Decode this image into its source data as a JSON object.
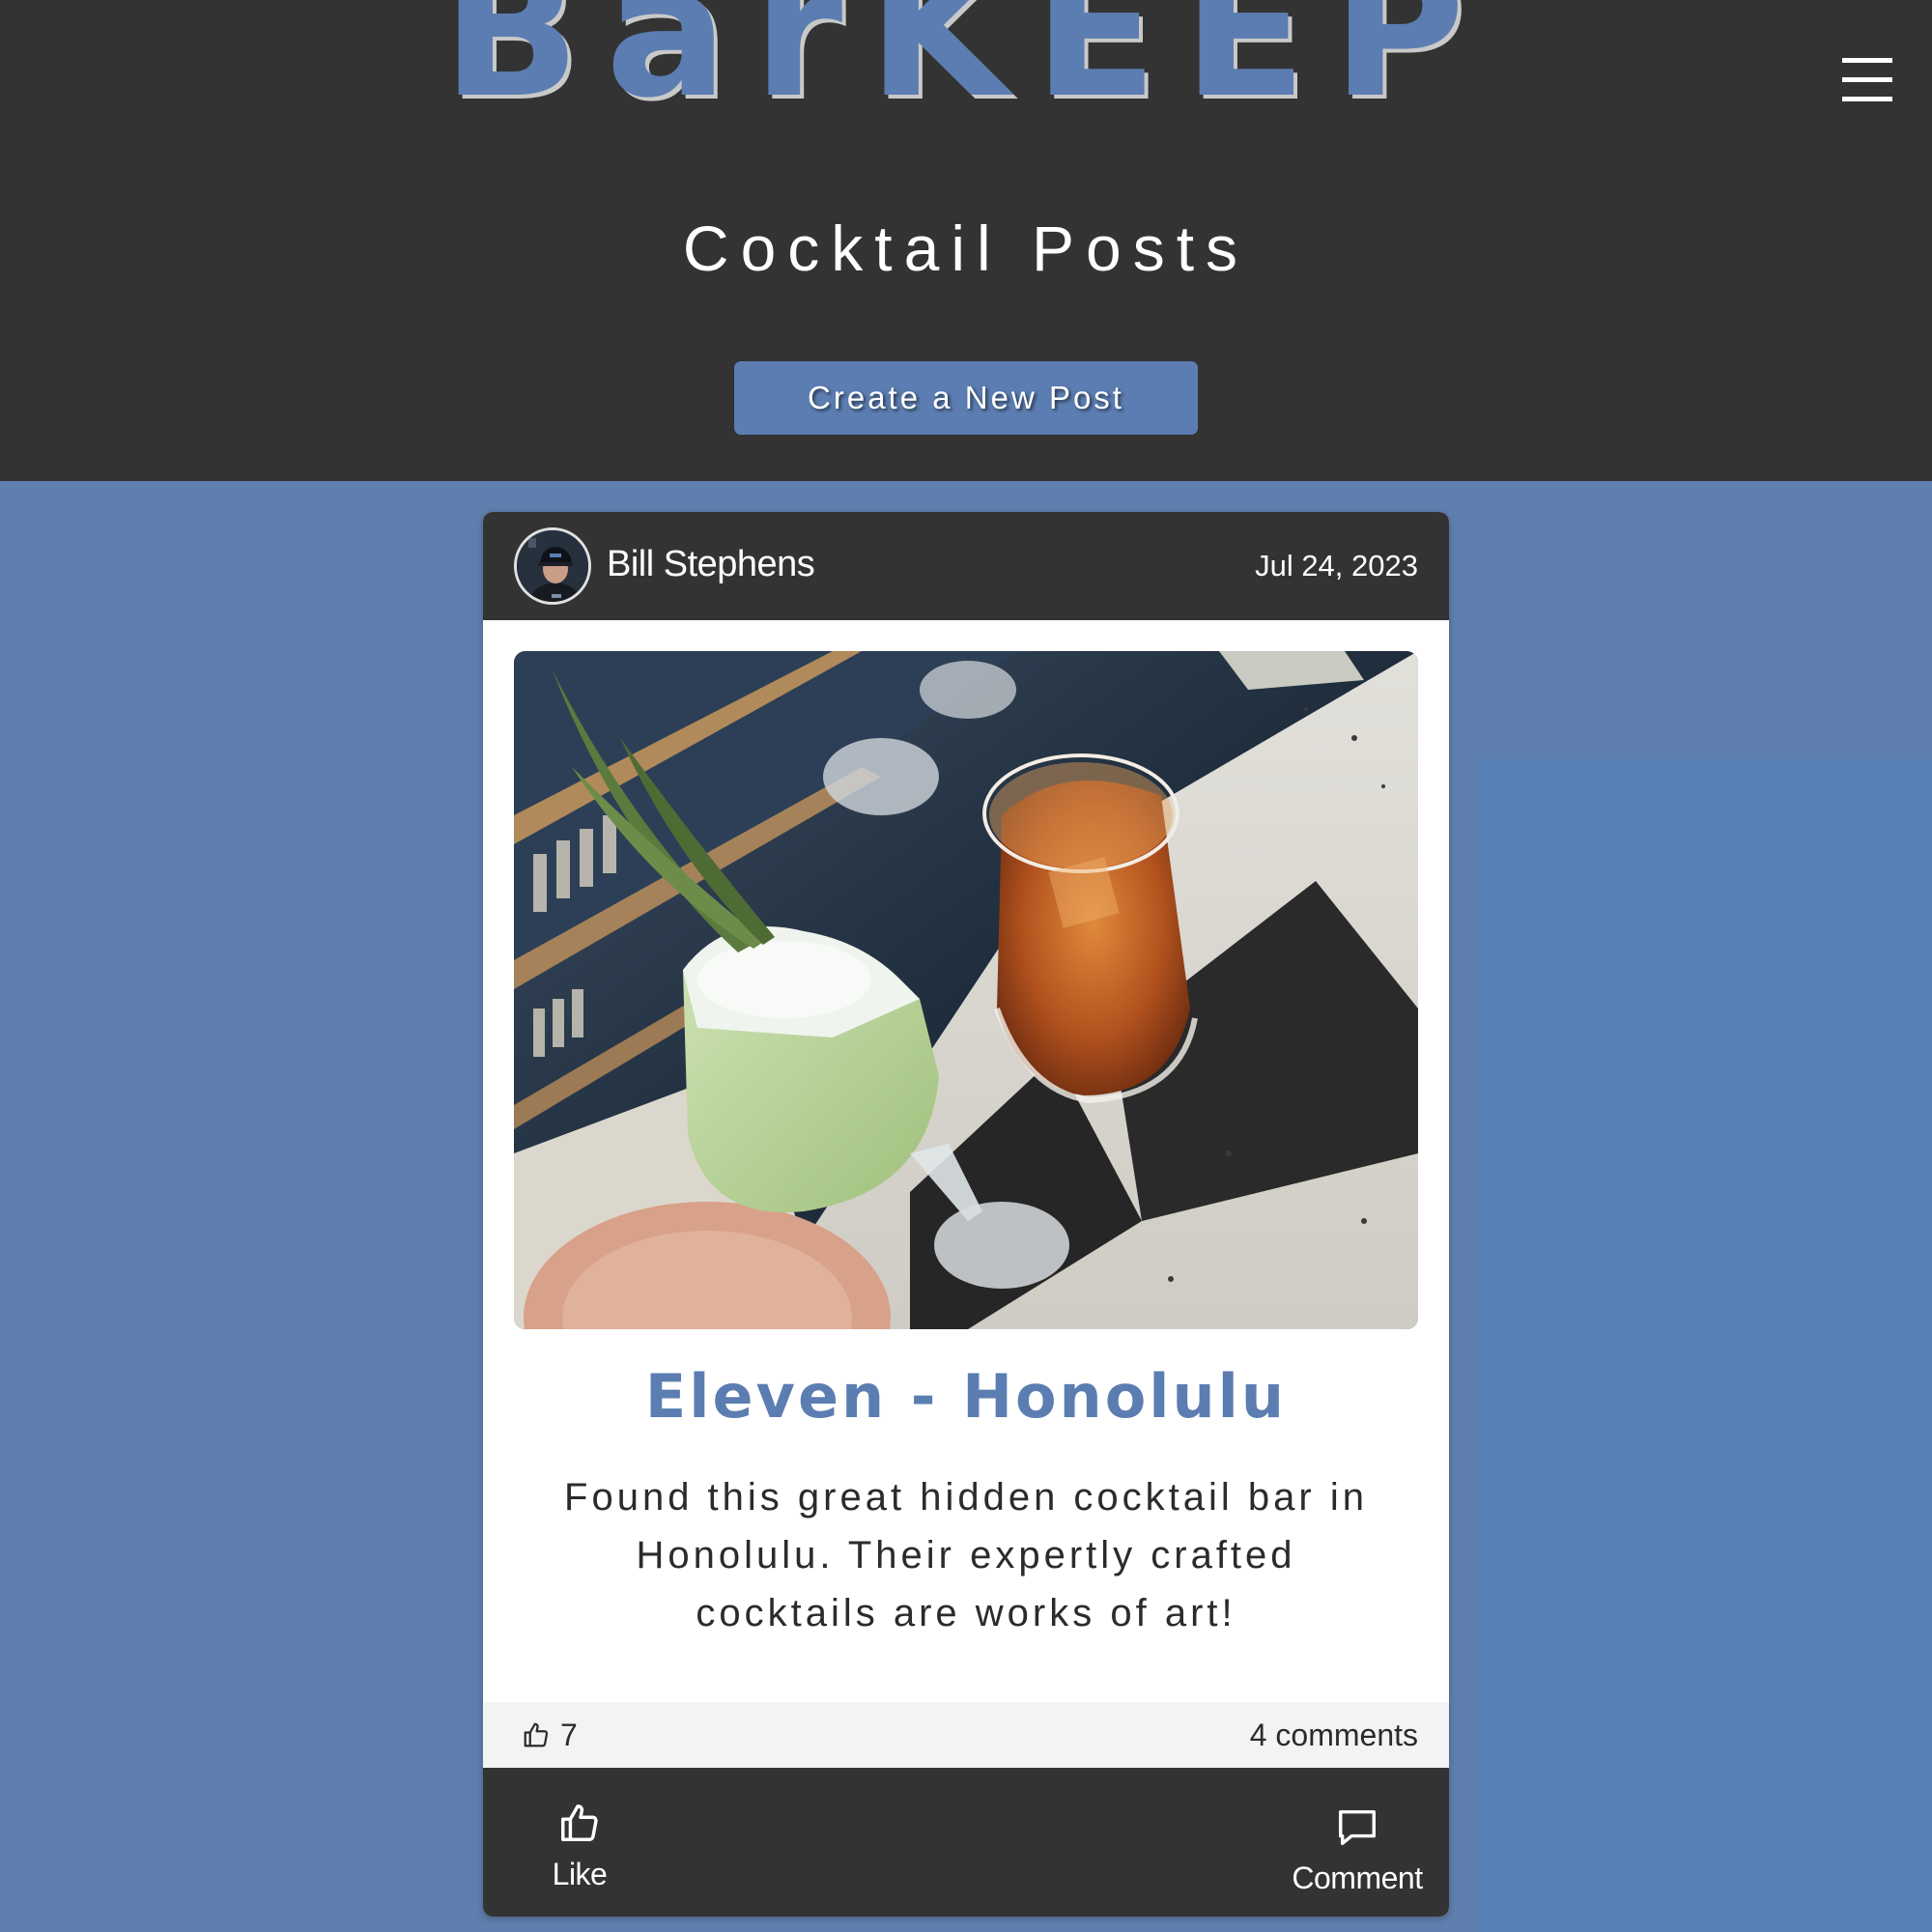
{
  "header": {
    "logo": "BarKEEP",
    "menu_icon": "hamburger-menu-icon",
    "page_title": "Cocktail Posts",
    "create_button_label": "Create a New Post"
  },
  "post": {
    "author_name": "Bill Stephens",
    "date": "Jul 24, 2023",
    "title": "Eleven - Honolulu",
    "body": "Found this great hidden cocktail bar in Honolulu. Their expertly crafted cocktails are works of art!",
    "like_count": "7",
    "comment_count": "4 comments",
    "like_button_label": "Like",
    "comment_button_label": "Comment"
  },
  "colors": {
    "accent": "#5b7db1",
    "dark": "#333333",
    "page_background": "#5f7fae",
    "stats_background": "#f3f3f3"
  }
}
